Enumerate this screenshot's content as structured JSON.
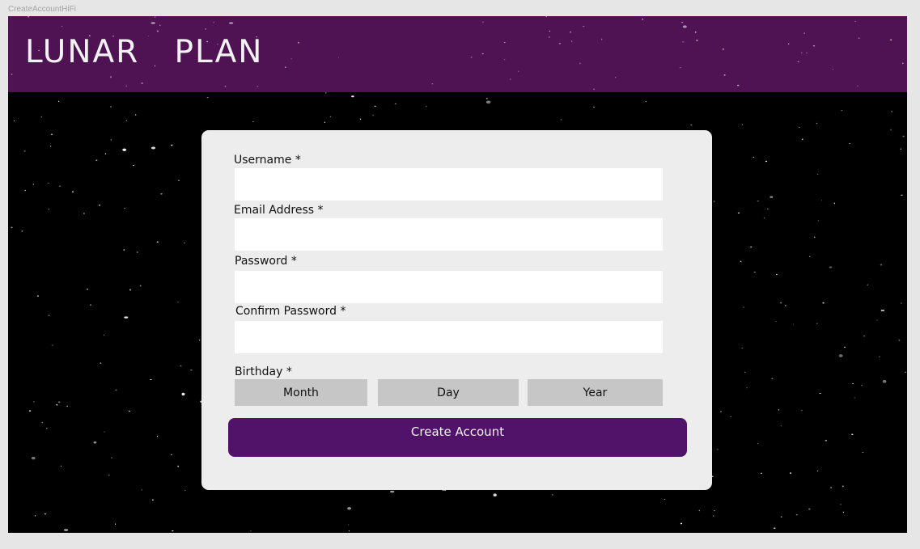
{
  "frame": {
    "name": "CreateAccountHiFi"
  },
  "header": {
    "logo_text": "LUNAR   PLAN",
    "background_color": "#4f1354"
  },
  "form": {
    "fields": {
      "username": {
        "label": "Username *",
        "value": ""
      },
      "email": {
        "label": "Email Address *",
        "value": ""
      },
      "password": {
        "label": "Password *",
        "value": ""
      },
      "confirm_password": {
        "label": "Confirm Password *",
        "value": ""
      }
    },
    "birthday": {
      "label": "Birthday *",
      "month": "Month",
      "day": "Day",
      "year": "Year"
    },
    "submit_label": "Create Account",
    "accent_color": "#51136a"
  }
}
